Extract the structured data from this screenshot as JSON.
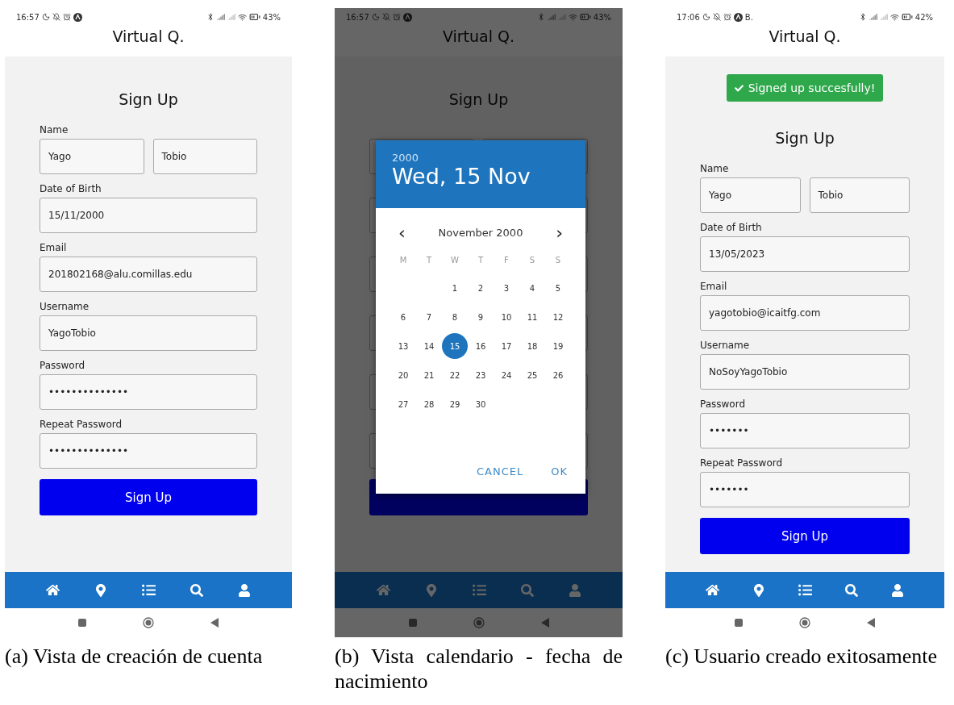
{
  "figures": [
    {
      "status": {
        "time": "16:57",
        "battery": "43%"
      },
      "app_title": "Virtual Q.",
      "dimmed": false,
      "form": {
        "heading": "Sign Up",
        "fields": [
          {
            "kind": "pair",
            "label": "Name",
            "values": [
              "Yago",
              "Tobio"
            ]
          },
          {
            "kind": "single",
            "label": "Date of Birth",
            "value": "15/11/2000"
          },
          {
            "kind": "single",
            "label": "Email",
            "value": "201802168@alu.comillas.edu"
          },
          {
            "kind": "single",
            "label": "Username",
            "value": "YagoTobio"
          },
          {
            "kind": "single",
            "label": "Password",
            "value": "••••••••••••••"
          },
          {
            "kind": "single",
            "label": "Repeat Password",
            "value": "••••••••••••••"
          }
        ],
        "button": "Sign Up"
      },
      "caption": "(a) Vista de creación de cuenta"
    },
    {
      "status": {
        "time": "16:57",
        "battery": "43%"
      },
      "app_title": "Virtual Q.",
      "dimmed": true,
      "form": {
        "heading": "Sign Up",
        "fields": [
          {
            "kind": "pair"
          },
          {
            "kind": "single"
          },
          {
            "kind": "single"
          },
          {
            "kind": "single"
          },
          {
            "kind": "single"
          },
          {
            "kind": "single"
          }
        ]
      },
      "dialog": {
        "year": "2000",
        "date": "Wed, 15 Nov",
        "month": "November 2000",
        "prev": "‹",
        "next": "›",
        "weekdays": [
          "M",
          "T",
          "W",
          "T",
          "F",
          "S",
          "S"
        ],
        "weeks": [
          {
            "leading_gap": true,
            "days": [
              {
                "label": "1",
                "selected": false
              },
              {
                "label": "2",
                "selected": false
              },
              {
                "label": "3",
                "selected": false
              },
              {
                "label": "4",
                "selected": false
              },
              {
                "label": "5",
                "selected": false
              }
            ]
          },
          {
            "days": [
              {
                "label": "6",
                "selected": false
              },
              {
                "label": "7",
                "selected": false
              },
              {
                "label": "8",
                "selected": false
              },
              {
                "label": "9",
                "selected": false
              },
              {
                "label": "10",
                "selected": false
              },
              {
                "label": "11",
                "selected": false
              },
              {
                "label": "12",
                "selected": false
              }
            ]
          },
          {
            "days": [
              {
                "label": "13",
                "selected": false
              },
              {
                "label": "14",
                "selected": false
              },
              {
                "label": "15",
                "selected": true
              },
              {
                "label": "16",
                "selected": false
              },
              {
                "label": "17",
                "selected": false
              },
              {
                "label": "18",
                "selected": false
              },
              {
                "label": "19",
                "selected": false
              }
            ]
          },
          {
            "days": [
              {
                "label": "20",
                "selected": false
              },
              {
                "label": "21",
                "selected": false
              },
              {
                "label": "22",
                "selected": false
              },
              {
                "label": "23",
                "selected": false
              },
              {
                "label": "24",
                "selected": false
              },
              {
                "label": "25",
                "selected": false
              },
              {
                "label": "26",
                "selected": false
              }
            ]
          },
          {
            "leading_gap": false,
            "days": [
              {
                "label": "27",
                "selected": false
              },
              {
                "label": "28",
                "selected": false
              },
              {
                "label": "29",
                "selected": false
              },
              {
                "label": "30",
                "selected": false
              }
            ]
          }
        ],
        "buttons": [
          "CANCEL",
          "OK"
        ]
      },
      "caption": "(b) Vista calendario - fecha de nacimiento"
    },
    {
      "status": {
        "time": "17:06",
        "extra": "B.",
        "battery": "42%"
      },
      "app_title": "Virtual Q.",
      "dimmed": false,
      "toast": "Signed up succesfully!",
      "form": {
        "heading": "Sign Up",
        "fields": [
          {
            "kind": "pair",
            "label": "Name",
            "values": [
              "Yago",
              "Tobio"
            ]
          },
          {
            "kind": "single",
            "label": "Date of Birth",
            "value": "13/05/2023"
          },
          {
            "kind": "single",
            "label": "Email",
            "value": "yagotobio@icaitfg.com"
          },
          {
            "kind": "single",
            "label": "Username",
            "value": "NoSoyYagoTobio"
          },
          {
            "kind": "single",
            "label": "Password",
            "value": "•••••••"
          },
          {
            "kind": "single",
            "label": "Repeat Password",
            "value": "•••••••"
          }
        ],
        "button": "Sign Up"
      },
      "caption": "(c) Usuario creado exitosamente"
    }
  ]
}
